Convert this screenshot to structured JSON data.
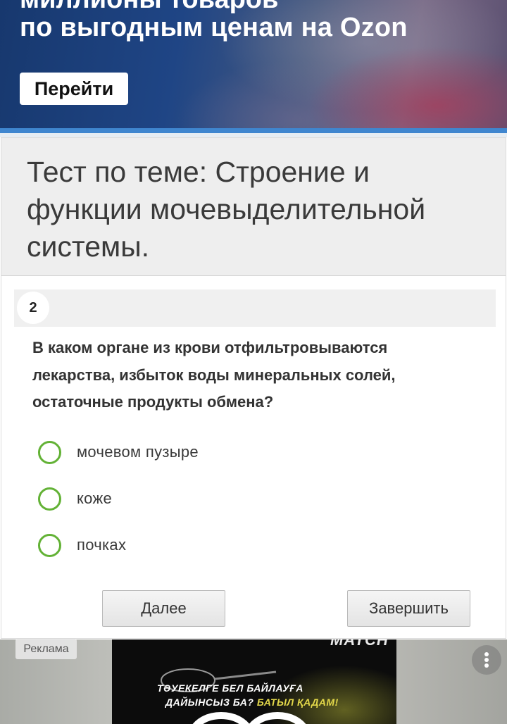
{
  "top_ad": {
    "headline_partial": "миллионы товаров",
    "headline": "по выгодным ценам на Ozon",
    "button_label": "Перейти"
  },
  "quiz": {
    "title": "Тест по теме: Строение и функции мочевыделительной системы.",
    "question_number": "2",
    "question_text": "В каком органе из крови отфильтровываются лекарства, избыток воды минеральных солей, остаточные продукты обмена?",
    "options": [
      {
        "label": "мочевом пузыре",
        "selected": false
      },
      {
        "label": "коже",
        "selected": false
      },
      {
        "label": "почках",
        "selected": false
      }
    ],
    "next_button": "Далее",
    "finish_button": "Завершить"
  },
  "bottom_ad": {
    "label": "Реклама",
    "brand_partial": "MATCH",
    "image_line1": "ТӘУЕКЕЛГЕ БЕЛ БАЙЛАУҒА",
    "image_line2_start": "ДАЙЫНСЫЗ БА?",
    "image_line2_accent": "БАТЫЛ ҚАДАМ!",
    "more_icon": "more-vertical-icon"
  },
  "colors": {
    "radio_ring": "#63b236",
    "banner_blue": "#1f4585",
    "accent_strip": "#3f86cf"
  }
}
